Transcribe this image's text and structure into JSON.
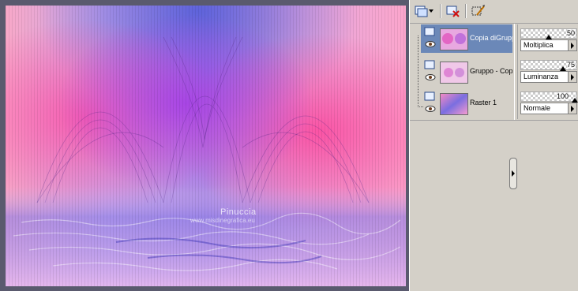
{
  "canvas": {
    "watermark_title": "Pinuccia",
    "watermark_url": "www.misdinegrafica.eu"
  },
  "toolbar": {
    "icons": [
      "new-layer-icon",
      "delete-layer-icon",
      "layer-properties-icon"
    ]
  },
  "layers": [
    {
      "name": "Copia diGruppo",
      "opacity": 50,
      "blend_mode": "Moltiplica",
      "selected": true
    },
    {
      "name": "Gruppo - Copia",
      "opacity": 75,
      "blend_mode": "Luminanza",
      "selected": false
    },
    {
      "name": "Raster 1",
      "opacity": 100,
      "blend_mode": "Normale",
      "selected": false
    }
  ],
  "colors": {
    "selection": "#6b88b8",
    "panel_bg": "#d4d0c8",
    "image_pink": "#f47ab4",
    "image_magenta": "#d84ad8",
    "image_blue": "#6a6ee0"
  }
}
